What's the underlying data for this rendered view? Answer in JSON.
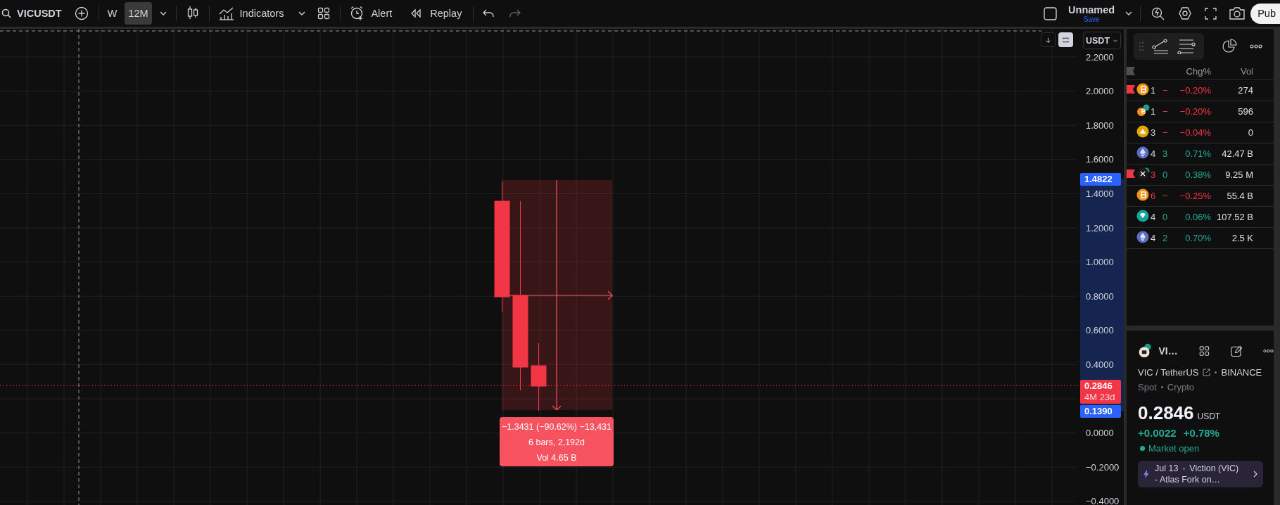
{
  "toolbar": {
    "symbol": "VICUSDT",
    "intervals": [
      {
        "label": "W",
        "selected": false
      },
      {
        "label": "12M",
        "selected": true
      }
    ],
    "indicators_label": "Indicators",
    "alert_label": "Alert",
    "replay_label": "Replay",
    "layout_name": "Unnamed",
    "save_label": "Save",
    "publish_label": "Pub"
  },
  "chart": {
    "currency": "USDT",
    "price_ticks_upper": [
      "2.2000",
      "2.0000",
      "1.8000",
      "1.6000",
      "1.4000",
      "1.2000",
      "1.0000",
      "0.8000",
      "0.6000",
      "0.4000"
    ],
    "price_ticks_lower": [
      "0.0000",
      "−0.2000",
      "−0.4000"
    ],
    "price_tags": [
      {
        "kind": "range",
        "label": "1.4822"
      },
      {
        "kind": "last",
        "label": "0.2846",
        "countdown": "4M 23d"
      },
      {
        "kind": "range",
        "label": "0.1390"
      }
    ],
    "measure": {
      "lines": [
        "−1.3431 (−90.62%) −13,431",
        "6 bars, 2,192d",
        "Vol 4.65 B"
      ]
    }
  },
  "watchlist": {
    "columns": [
      "Chg%",
      "Vol"
    ],
    "rows": [
      {
        "flagged": true,
        "kind": "bitcoin",
        "badge": false,
        "symbol": "1",
        "color": "#d1d4dc",
        "change": "−",
        "chg_percent": "−0.20%",
        "negative": true,
        "volume": "274"
      },
      {
        "flagged": false,
        "kind": "bitcoin",
        "badge": true,
        "symbol": "1",
        "color": "#d1d4dc",
        "change": "−",
        "chg_percent": "−0.20%",
        "negative": true,
        "volume": "596"
      },
      {
        "flagged": false,
        "kind": "gold",
        "badge": false,
        "symbol": "3",
        "color": "#d1d4dc",
        "change": "−",
        "chg_percent": "−0.04%",
        "negative": true,
        "volume": "0"
      },
      {
        "flagged": false,
        "kind": "ether",
        "badge": false,
        "symbol": "4",
        "color": "#d1d4dc",
        "change": "3",
        "chg_percent": "0.71%",
        "negative": false,
        "volume": "42.47 B"
      },
      {
        "flagged": true,
        "kind": "x",
        "badge": true,
        "symbol": "3",
        "color": "#f23645",
        "change": "0",
        "chg_percent": "0.38%",
        "negative": false,
        "volume": "9.25 M"
      },
      {
        "flagged": false,
        "kind": "bitcoin",
        "badge": false,
        "symbol": "6",
        "color": "#f23645",
        "change": "−",
        "chg_percent": "−0.25%",
        "negative": true,
        "volume": "55.4 B"
      },
      {
        "flagged": false,
        "kind": "diamond",
        "badge": false,
        "symbol": "4",
        "color": "#d1d4dc",
        "change": "0",
        "chg_percent": "0.06%",
        "negative": false,
        "volume": "107.52 B"
      },
      {
        "flagged": false,
        "kind": "ether",
        "badge": false,
        "symbol": "4",
        "color": "#d1d4dc",
        "change": "2",
        "chg_percent": "0.70%",
        "negative": false,
        "volume": "2.5 K"
      }
    ]
  },
  "details": {
    "symbol_short": "VI…",
    "name": "VIC / TetherUS",
    "exchange": "BINANCE",
    "type": "Spot",
    "category": "Crypto",
    "price": "0.2846",
    "currency": "USDT",
    "change": "+0.0022",
    "change_percent": "+0.78%",
    "market_status": "Market open",
    "event": {
      "date": "Jul 13",
      "title": "Viction (VIC)",
      "subtitle": "- Atlas Fork on…"
    }
  }
}
